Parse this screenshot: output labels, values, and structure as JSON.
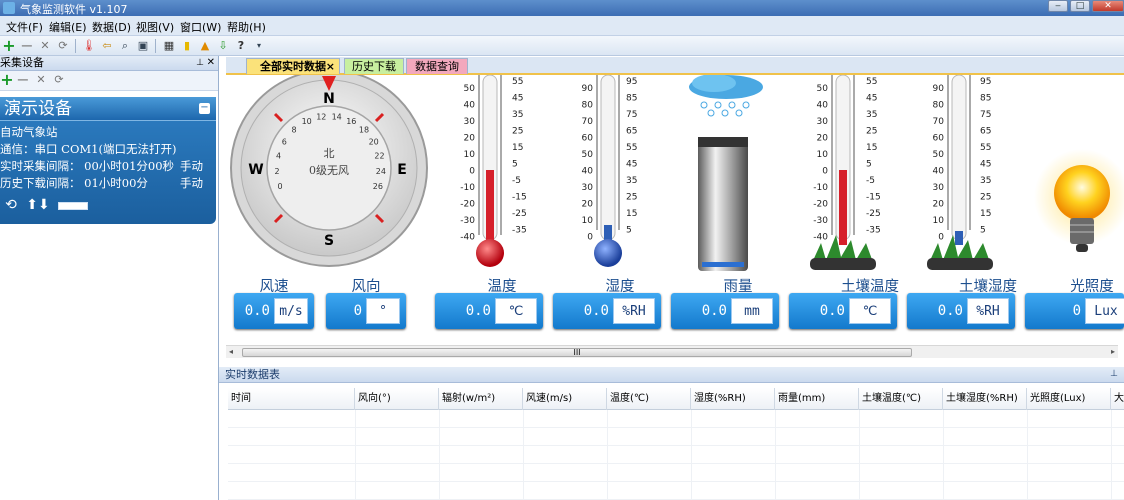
{
  "window": {
    "title": "气象监测软件 v1.107"
  },
  "menu": [
    "文件(F)",
    "编辑(E)",
    "数据(D)",
    "视图(V)",
    "窗口(W)",
    "帮助(H)"
  ],
  "left_panel": {
    "title": "采集设备",
    "device": {
      "name": "演示设备",
      "lines": [
        {
          "label": "自动气象站",
          "right": ""
        },
        {
          "label": "通信：串口 COM1(端口无法打开)",
          "right": ""
        },
        {
          "label": "实时采集间隔：  00小时01分00秒",
          "right": "手动"
        },
        {
          "label": "历史下载间隔：  01小时00分",
          "right": "手动"
        }
      ]
    }
  },
  "tabs": [
    "全部实时数据",
    "历史下载",
    "数据查询"
  ],
  "compass": {
    "north_top": "N",
    "south": "S",
    "east": "E",
    "west": "W",
    "direction": "北",
    "wind_level": "0级无风"
  },
  "gauge_scales": {
    "temp_left": [
      "50",
      "40",
      "30",
      "20",
      "10",
      "0",
      "-10",
      "-20",
      "-30",
      "-40"
    ],
    "temp_right": [
      "55",
      "45",
      "35",
      "25",
      "15",
      "5",
      "-5",
      "-15",
      "-25",
      "-35"
    ],
    "hum_left": [
      "90",
      "80",
      "70",
      "60",
      "50",
      "40",
      "30",
      "20",
      "10",
      "0"
    ],
    "hum_right": [
      "95",
      "85",
      "75",
      "65",
      "55",
      "45",
      "35",
      "25",
      "15",
      "5"
    ],
    "wind_numbers": [
      "0",
      "2",
      "4",
      "6",
      "8",
      "10",
      "12",
      "14",
      "16",
      "18",
      "20",
      "22",
      "24",
      "26"
    ]
  },
  "sensors": [
    {
      "label": "风速",
      "value": "0.0",
      "unit": "m/s"
    },
    {
      "label": "风向",
      "value": "0",
      "unit": "°"
    },
    {
      "label": "温度",
      "value": "0.0",
      "unit": "℃"
    },
    {
      "label": "湿度",
      "value": "0.0",
      "unit": "%RH"
    },
    {
      "label": "雨量",
      "value": "0.0",
      "unit": "mm"
    },
    {
      "label": "土壤温度",
      "value": "0.0",
      "unit": "℃"
    },
    {
      "label": "土壤湿度",
      "value": "0.0",
      "unit": "%RH"
    },
    {
      "label": "光照度",
      "value": "0",
      "unit": "Lux"
    }
  ],
  "scrollbar_grip": "III",
  "realtime_table": {
    "title": "实时数据表",
    "columns": [
      "时间",
      "风向(°)",
      "辐射(w/m²)",
      "风速(m/s)",
      "温度(℃)",
      "湿度(%RH)",
      "雨量(mm)",
      "土壤温度(℃)",
      "土壤湿度(%RH)",
      "光照度(Lux)",
      "大"
    ]
  },
  "colors": {
    "accent_blue": "#1b76c9",
    "tab_active": "#fbe27a",
    "tab_history": "#c8ef9f",
    "tab_query": "#f3a8bd",
    "mercury_red": "#d6202b",
    "humidity_blue": "#2e5fb6"
  }
}
